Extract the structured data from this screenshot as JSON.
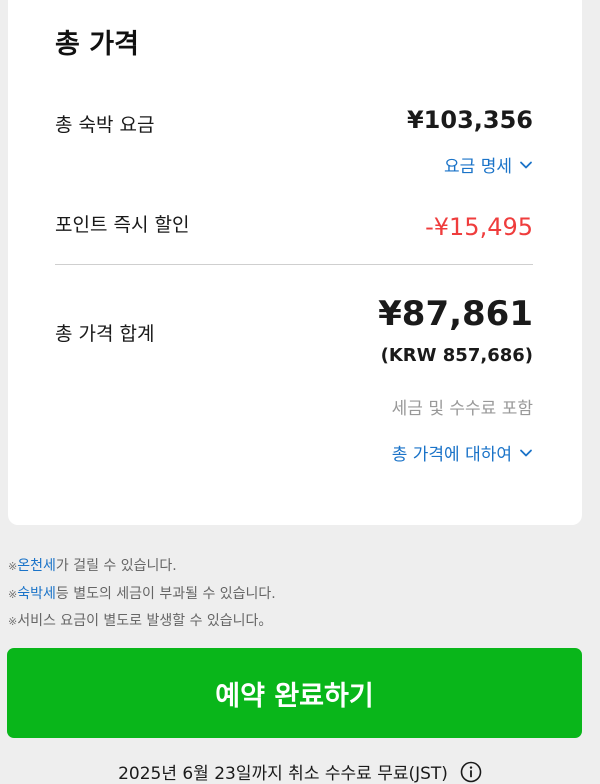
{
  "summary": {
    "title": "총 가격",
    "room_rate_label": "총 숙박 요금",
    "room_rate_value": "¥103,356",
    "rate_details_link": "요금 명세",
    "points_label": "포인트 즉시 할인",
    "points_value": "-¥15,495",
    "total_label": "총 가격 합계",
    "total_value": "¥87,861",
    "total_krw": "(KRW 857,686)",
    "tax_included": "세금 및 수수료 포함",
    "about_total_link": "총 가격에 대하여"
  },
  "notes": [
    {
      "mark": "※",
      "highlight": "온천세",
      "rest": "가 걸릴 수 있습니다."
    },
    {
      "mark": "※",
      "highlight": "숙박세",
      "rest": "등 별도의 세금이 부과될 수 있습니다."
    },
    {
      "mark": "※",
      "highlight": "",
      "rest": "서비스 요금이 별도로 발생할 수 있습니다。"
    }
  ],
  "cta": {
    "label": "예약 완료하기"
  },
  "cancellation": {
    "text": "2025년 6월 23일까지 취소 수수료 무료(JST)"
  },
  "colors": {
    "accent_link": "#1a73c8",
    "discount": "#ef3d3d",
    "cta_background": "#09b61a"
  },
  "icons": {
    "chevron": "chevron-down-icon",
    "info": "info-icon"
  }
}
